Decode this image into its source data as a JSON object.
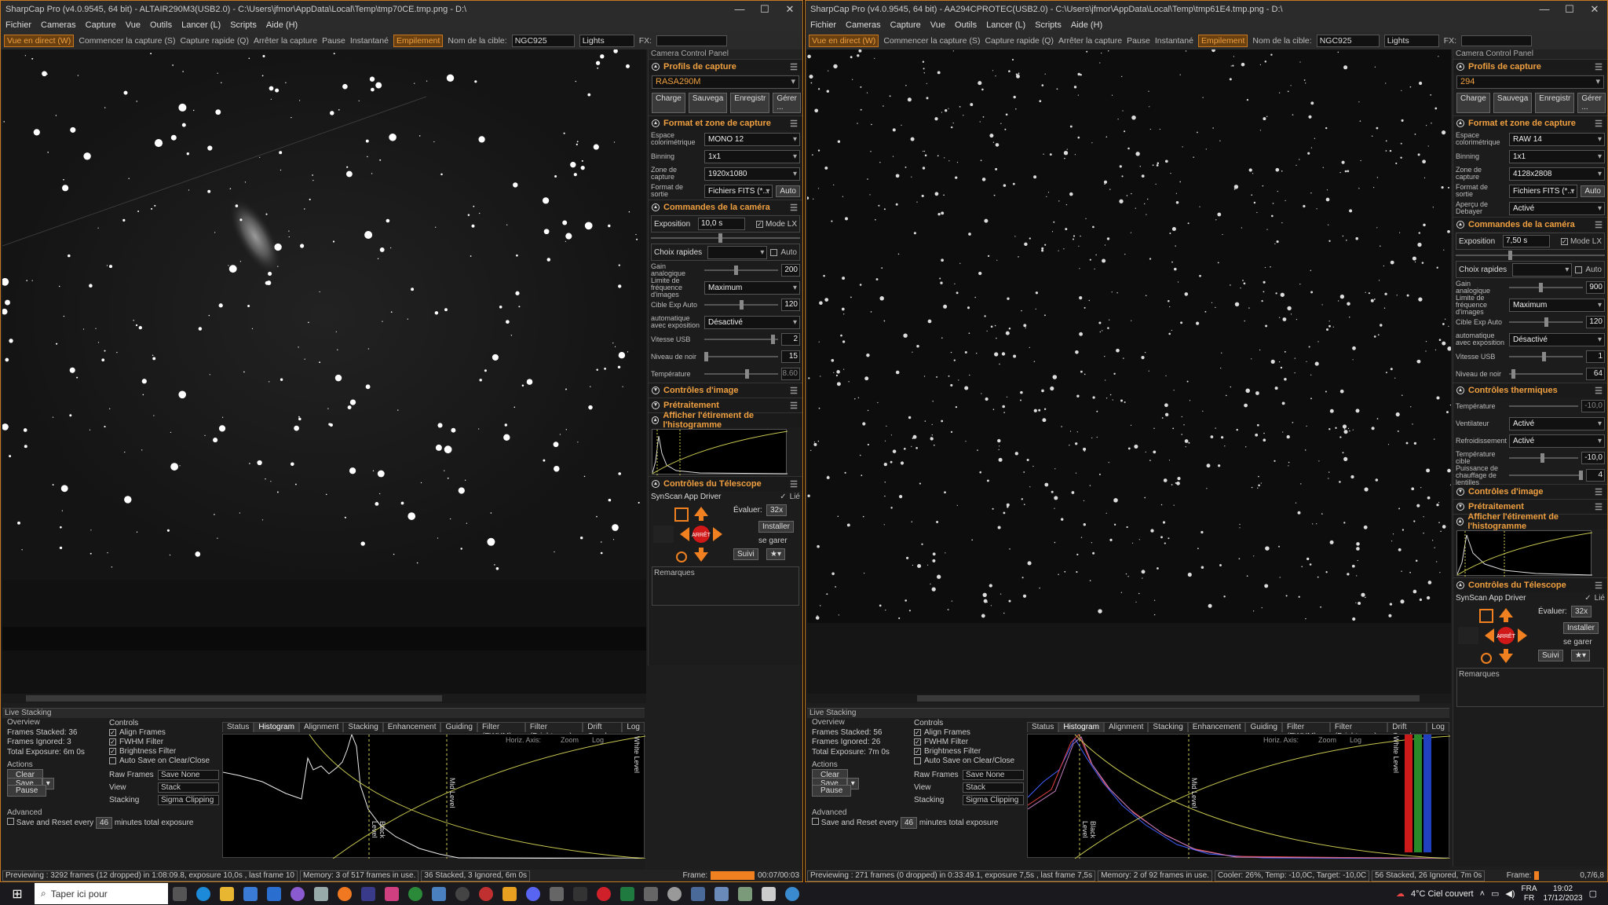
{
  "left": {
    "title": "SharpCap Pro (v4.0.9545, 64 bit) - ALTAIR290M3(USB2.0) - C:\\Users\\jfmor\\AppData\\Local\\Temp\\tmp70CE.tmp.png - D:\\",
    "menu": [
      "Fichier",
      "Cameras",
      "Capture",
      "Vue",
      "Outils",
      "Lancer (L)",
      "Scripts",
      "Aide (H)"
    ],
    "toolbar": {
      "live": "Vue en direct (W)",
      "start": "Commencer la capture (S)",
      "quick": "Capture rapide (Q)",
      "stop": "Arrêter la capture",
      "pause": "Pause",
      "snapshot": "Instantané",
      "stack": "Empilement",
      "target_label": "Nom de la cible:",
      "target": "NGC925",
      "filter": "Lights",
      "fx": "FX:"
    },
    "panel_title": "Camera Control Panel",
    "profile_header": "Profils de capture",
    "profile": "RASA290M",
    "profile_buttons": [
      "Charge",
      "Sauvega",
      "Enregistr",
      "Gérer ..."
    ],
    "format_header": "Format et zone de capture",
    "format_rows": [
      {
        "label": "Espace colorimétrique",
        "value": "MONO 12"
      },
      {
        "label": "Binning",
        "value": "1x1"
      },
      {
        "label": "Zone de capture",
        "value": "1920x1080"
      },
      {
        "label": "Format de sortie",
        "value": "Fichiers FITS (*..."
      }
    ],
    "auto": "Auto",
    "cam_header": "Commandes de la caméra",
    "exposure_label": "Exposition",
    "exposure": "10,0 s",
    "mode_lx": "Mode LX",
    "quick_choice": "Choix rapides",
    "auto2": "Auto",
    "sliders": [
      {
        "label": "Gain analogique",
        "value": "200"
      },
      {
        "label": "Limite de fréquence d'images",
        "value": "Maximum"
      },
      {
        "label": "Cible Exp Auto",
        "value": "120"
      },
      {
        "label": "automatique avec exposition",
        "value": "Désactivé"
      },
      {
        "label": "Vitesse USB",
        "value": "2"
      },
      {
        "label": "Niveau de noir",
        "value": "15"
      },
      {
        "label": "Température",
        "value": "8.60"
      }
    ],
    "sections2": [
      "Contrôles d'image",
      "Prétraitement",
      "Afficher l'étirement de l'histogramme"
    ],
    "telescope_header": "Contrôles du Télescope",
    "driver": "SynScan App Driver",
    "linked": "Lié",
    "rate_label": "Évaluer:",
    "rate": "32x",
    "install": "Installer",
    "park": "se garer",
    "track": "Suivi",
    "stop": "ARRÊT",
    "remarks": "Remarques",
    "ls_title": "Live Stacking",
    "overview": [
      "Overview",
      "Frames Stacked: 36",
      "Frames Ignored: 3",
      "Total Exposure: 6m 0s"
    ],
    "actions": "Actions",
    "clear": "Clear",
    "save": "Save",
    "pause": "Pause",
    "advanced": "Advanced",
    "save_reset": "Save and Reset every",
    "minutes": "46",
    "minutes_label": "minutes total exposure",
    "controls": "Controls",
    "checks": [
      "Align Frames",
      "FWHM Filter",
      "Brightness Filter",
      "Auto Save on Clear/Close"
    ],
    "raw_frames": {
      "label": "Raw Frames",
      "value": "Save None"
    },
    "view": {
      "label": "View",
      "value": "Stack"
    },
    "stacking": {
      "label": "Stacking",
      "value": "Sigma Clipping"
    },
    "tabs": [
      "Status",
      "Histogram",
      "Alignment",
      "Stacking",
      "Enhancement",
      "Guiding",
      "Filter (FWHM)",
      "Filter (Brightness)",
      "Drift Graph",
      "Log"
    ],
    "hist_opts": [
      "Horiz. Axis:",
      "Zoom",
      "Log"
    ],
    "black_level": "Black Level",
    "mid_level": "Mid Level",
    "white_level": "White Level",
    "status": [
      "Previewing : 3292 frames (12 dropped) in 1:08:09.8, exposure 10,0s , last frame 10",
      "Memory: 3 of 517 frames in use.",
      "36 Stacked, 3 Ignored, 6m 0s"
    ],
    "frame_label": "Frame:",
    "frame_time": "00:07/00:03"
  },
  "right": {
    "title": "SharpCap Pro (v4.0.9545, 64 bit) - AA294CPROTEC(USB2.0) - C:\\Users\\jfmor\\AppData\\Local\\Temp\\tmp61E4.tmp.png - D:\\",
    "menu": [
      "Fichier",
      "Cameras",
      "Capture",
      "Vue",
      "Outils",
      "Lancer (L)",
      "Scripts",
      "Aide (H)"
    ],
    "toolbar": {
      "live": "Vue en direct (W)",
      "start": "Commencer la capture (S)",
      "quick": "Capture rapide (Q)",
      "stop": "Arrêter la capture",
      "pause": "Pause",
      "snapshot": "Instantané",
      "stack": "Empilement",
      "target_label": "Nom de la cible:",
      "target": "NGC925",
      "filter": "Lights",
      "fx": "FX:"
    },
    "panel_title": "Camera Control Panel",
    "profile_header": "Profils de capture",
    "profile": "294",
    "profile_buttons": [
      "Charge",
      "Sauvega",
      "Enregistr",
      "Gérer ..."
    ],
    "format_header": "Format et zone de capture",
    "format_rows": [
      {
        "label": "Espace colorimétrique",
        "value": "RAW 14"
      },
      {
        "label": "Binning",
        "value": "1x1"
      },
      {
        "label": "Zone de capture",
        "value": "4128x2808"
      },
      {
        "label": "Format de sortie",
        "value": "Fichiers FITS (*..."
      },
      {
        "label": "Aperçu de Debayer",
        "value": "Activé"
      }
    ],
    "auto": "Auto",
    "cam_header": "Commandes de la caméra",
    "exposure_label": "Exposition",
    "exposure": "7,50 s",
    "mode_lx": "Mode LX",
    "quick_choice": "Choix rapides",
    "auto2": "Auto",
    "sliders": [
      {
        "label": "Gain analogique",
        "value": "900"
      },
      {
        "label": "Limite de fréquence d'images",
        "value": "Maximum"
      },
      {
        "label": "Cible Exp Auto",
        "value": "120"
      },
      {
        "label": "automatique avec exposition",
        "value": "Désactivé"
      },
      {
        "label": "Vitesse USB",
        "value": "1"
      },
      {
        "label": "Niveau de noir",
        "value": "64"
      }
    ],
    "thermal_header": "Contrôles thermiques",
    "thermal": [
      {
        "label": "Température",
        "value": "-10,0"
      },
      {
        "label": "Ventilateur",
        "value": "Activé"
      },
      {
        "label": "Refroidissement",
        "value": "Activé"
      },
      {
        "label": "Température cible",
        "value": "-10,0"
      },
      {
        "label": "Puissance de chauffage de lentilles",
        "value": "4"
      }
    ],
    "sections2": [
      "Contrôles d'image",
      "Prétraitement",
      "Afficher l'étirement de l'histogramme"
    ],
    "telescope_header": "Contrôles du Télescope",
    "driver": "SynScan App Driver",
    "linked": "Lié",
    "rate_label": "Évaluer:",
    "rate": "32x",
    "install": "Installer",
    "park": "se garer",
    "track": "Suivi",
    "stop": "ARRÊT",
    "remarks": "Remarques",
    "ls_title": "Live Stacking",
    "overview": [
      "Overview",
      "Frames Stacked: 56",
      "Frames Ignored: 26",
      "Total Exposure: 7m 0s"
    ],
    "actions": "Actions",
    "clear": "Clear",
    "save": "Save",
    "pause": "Pause",
    "advanced": "Advanced",
    "save_reset": "Save and Reset every",
    "minutes": "46",
    "minutes_label": "minutes total exposure",
    "controls": "Controls",
    "checks": [
      "Align Frames",
      "FWHM Filter",
      "Brightness Filter",
      "Auto Save on Clear/Close"
    ],
    "raw_frames": {
      "label": "Raw Frames",
      "value": "Save None"
    },
    "view": {
      "label": "View",
      "value": "Stack"
    },
    "stacking": {
      "label": "Stacking",
      "value": "Sigma Clipping"
    },
    "tabs": [
      "Status",
      "Histogram",
      "Alignment",
      "Stacking",
      "Enhancement",
      "Guiding",
      "Filter (FWHM)",
      "Filter (Brightness)",
      "Drift Graph",
      "Log"
    ],
    "hist_opts": [
      "Horiz. Axis:",
      "Zoom",
      "Log"
    ],
    "black_level": "Black Level",
    "mid_level": "Mid Level",
    "white_level": "White Level",
    "status": [
      "Previewing : 271 frames (0 dropped) in 0:33:49.1, exposure 7,5s , last frame 7,5s",
      "Memory: 2 of 92 frames in use.",
      "Cooler: 26%, Temp: -10,0C, Target: -10,0C",
      "56 Stacked, 26 Ignored, 7m 0s"
    ],
    "frame_label": "Frame:",
    "frame_time": "0,7/6,8"
  },
  "taskbar": {
    "search": "Taper ici pour",
    "weather": "4°C Ciel couvert",
    "lang": "FRA",
    "lang2": "FR",
    "time": "19:02",
    "date": "17/12/2023"
  },
  "colors": {
    "accent": "#f0a040",
    "border": "#c8781e"
  }
}
